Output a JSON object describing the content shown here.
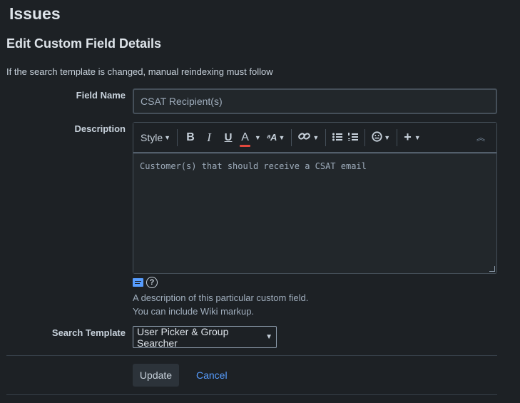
{
  "app": {
    "title": "Issues"
  },
  "section": {
    "title": "Edit Custom Field Details"
  },
  "notice": "If the search template is changed, manual reindexing must follow",
  "fields": {
    "field_name": {
      "label": "Field Name",
      "value": "CSAT Recipient(s)"
    },
    "description": {
      "label": "Description",
      "value": "Customer(s) that should receive a CSAT email",
      "toolbar": {
        "style_label": "Style",
        "bold": "B",
        "italic": "I",
        "underline": "U",
        "text_color": "A",
        "text_color_accent": "#e2483d",
        "more_formatting": "ᵃA",
        "link_icon": "link-icon",
        "bullet_list_icon": "bullet-list-icon",
        "numbered_list_icon": "numbered-list-icon",
        "emoji_icon": "emoji-icon",
        "insert_icon": "plus-icon",
        "collapse_icon": "collapse-icon"
      },
      "help_line1": "A description of this particular custom field.",
      "help_line2": "You can include Wiki markup."
    },
    "search_template": {
      "label": "Search Template",
      "value": "User Picker & Group Searcher"
    }
  },
  "actions": {
    "update_label": "Update",
    "cancel_label": "Cancel"
  },
  "colors": {
    "background": "#1d2125",
    "link": "#579dff"
  }
}
